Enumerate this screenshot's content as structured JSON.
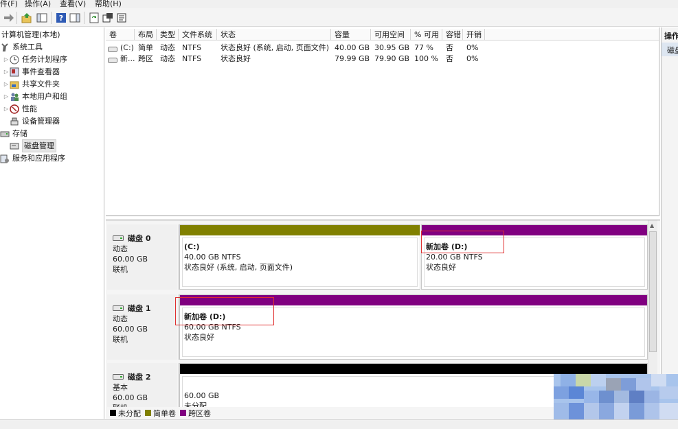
{
  "menu": {
    "items": [
      "件(F)",
      "操作(A)",
      "查看(V)",
      "帮助(H)"
    ]
  },
  "toolbar": {
    "buttons": [
      "back-icon",
      "forward-icon",
      "up-icon",
      "show-hide-tree-icon",
      "help-icon",
      "action-pane-icon",
      "refresh-icon",
      "properties-icon",
      "export-icon"
    ]
  },
  "tree": {
    "root": "计算机管理(本地)",
    "system_tools": "系统工具",
    "task_scheduler": "任务计划程序",
    "event_viewer": "事件查看器",
    "shared_folders": "共享文件夹",
    "local_users": "本地用户和组",
    "performance": "性能",
    "device_manager": "设备管理器",
    "storage": "存储",
    "disk_management": "磁盘管理",
    "services_apps": "服务和应用程序"
  },
  "volume_table": {
    "headers": [
      "卷",
      "布局",
      "类型",
      "文件系统",
      "状态",
      "容量",
      "可用空间",
      "% 可用",
      "容错",
      "开销"
    ],
    "rows": [
      [
        "(C:)",
        "简单",
        "动态",
        "NTFS",
        "状态良好 (系统, 启动, 页面文件)",
        "40.00 GB",
        "30.95 GB",
        "77 %",
        "否",
        "0%"
      ],
      [
        "新...",
        "跨区",
        "动态",
        "NTFS",
        "状态良好",
        "79.99 GB",
        "79.90 GB",
        "100 %",
        "否",
        "0%"
      ]
    ]
  },
  "disks": [
    {
      "name": "磁盘 0",
      "type": "动态",
      "size": "60.00 GB",
      "status": "联机",
      "partitions": [
        {
          "title": "(C:)",
          "size_fs": "40.00 GB NTFS",
          "status": "状态良好 (系统, 启动, 页面文件)",
          "color": "#808000",
          "share": 0.53
        },
        {
          "title": "新加卷  (D:)",
          "size_fs": "20.00 GB NTFS",
          "status": "状态良好",
          "color": "#800080",
          "share": 0.47
        }
      ]
    },
    {
      "name": "磁盘 1",
      "type": "动态",
      "size": "60.00 GB",
      "status": "联机",
      "partitions": [
        {
          "title": "新加卷  (D:)",
          "size_fs": "60.00 GB NTFS",
          "status": "状态良好",
          "color": "#800080",
          "share": 1.0
        }
      ]
    },
    {
      "name": "磁盘 2",
      "type": "基本",
      "size": "60.00 GB",
      "status": "联机",
      "partitions": [
        {
          "title": "",
          "size_fs": "60.00 GB",
          "status": "未分配",
          "color": "#000000",
          "share": 1.0
        }
      ]
    }
  ],
  "legend": [
    {
      "label": "未分配",
      "color": "#000000"
    },
    {
      "label": "简单卷",
      "color": "#808000"
    },
    {
      "label": "跨区卷",
      "color": "#800080"
    }
  ],
  "actions": {
    "header": "操作",
    "item": "磁盘管理"
  }
}
